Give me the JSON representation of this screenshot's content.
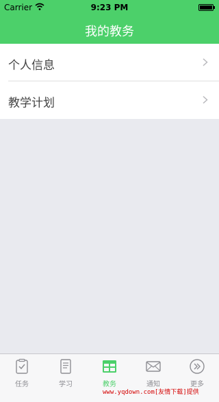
{
  "status_bar": {
    "carrier": "Carrier",
    "time": "9:23 PM"
  },
  "navbar": {
    "title": "我的教务"
  },
  "list": {
    "items": [
      {
        "label": "个人信息"
      },
      {
        "label": "教学计划"
      }
    ]
  },
  "tabbar": {
    "active_color": "#4cd06a",
    "tabs": [
      {
        "label": "任务",
        "icon": "clipboard-check-icon"
      },
      {
        "label": "学习",
        "icon": "book-icon"
      },
      {
        "label": "教务",
        "icon": "grid-table-icon",
        "active": true
      },
      {
        "label": "通知",
        "icon": "envelope-icon"
      },
      {
        "label": "更多",
        "icon": "double-chevron-right-icon"
      }
    ]
  },
  "watermark": "www.yqdown.com[友情下载]提供"
}
